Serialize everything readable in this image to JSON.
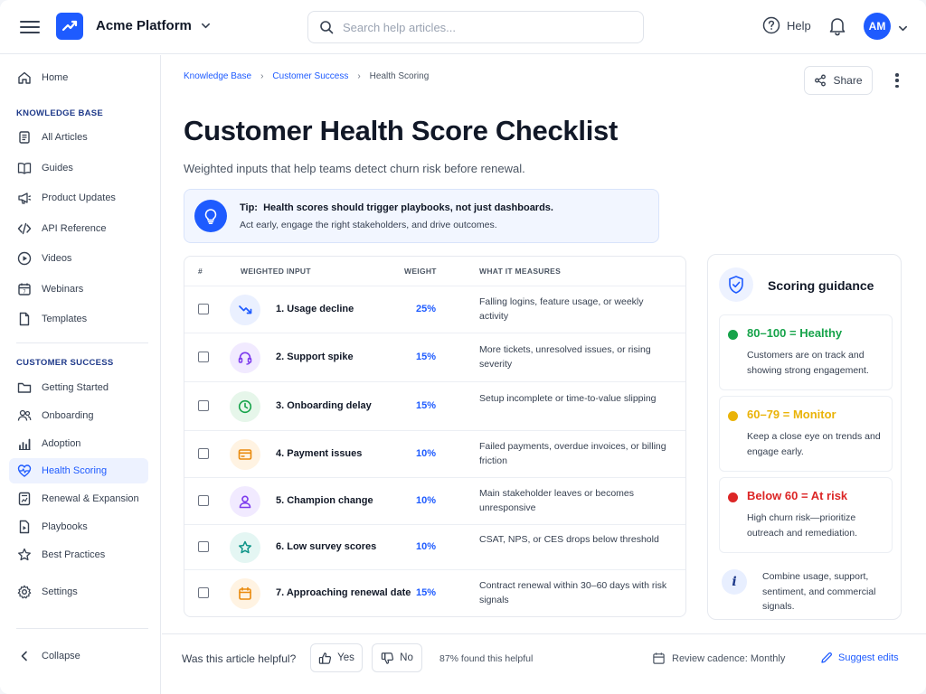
{
  "header": {
    "brand": "Acme Platform",
    "search_placeholder": "Search help articles...",
    "help_label": "Help",
    "avatar_initials": "AM"
  },
  "sidebar": {
    "home": "Home",
    "section_kb": "KNOWLEDGE BASE",
    "kb_items": [
      "All Articles",
      "Guides",
      "Product Updates",
      "API Reference",
      "Videos",
      "Webinars",
      "Templates"
    ],
    "section_cs": "CUSTOMER SUCCESS",
    "cs_items": [
      "Getting Started",
      "Onboarding",
      "Adoption",
      "Health Scoring",
      "Renewal & Expansion",
      "Playbooks",
      "Best Practices"
    ],
    "active_item": "Health Scoring",
    "settings": "Settings",
    "collapse": "Collapse"
  },
  "breadcrumb": {
    "items": [
      "Knowledge Base",
      "Customer Success"
    ],
    "current": "Health Scoring"
  },
  "share_label": "Share",
  "article": {
    "title": "Customer Health Score Checklist",
    "subtitle": "Weighted inputs that help teams detect churn risk before renewal.",
    "tip_prefix": "Tip:",
    "tip_headline": "Health scores should trigger playbooks, not just dashboards.",
    "tip_body": "Act early, engage the right stakeholders, and drive outcomes."
  },
  "table": {
    "headers": [
      "#",
      "WEIGHTED INPUT",
      "WEIGHT",
      "WHAT IT MEASURES"
    ],
    "rows": [
      {
        "name": "1. Usage decline",
        "weight": "25%",
        "desc": "Falling logins, feature usage, or weekly activity",
        "icon": "trend-down-icon"
      },
      {
        "name": "2. Support spike",
        "weight": "15%",
        "desc": "More tickets, unresolved issues, or rising severity",
        "icon": "headset-icon"
      },
      {
        "name": "3. Onboarding delay",
        "weight": "15%",
        "desc": "Setup incomplete or time-to-value slipping",
        "icon": "clock-icon"
      },
      {
        "name": "4. Payment issues",
        "weight": "10%",
        "desc": "Failed payments, overdue invoices, or billing friction",
        "icon": "credit-card-icon"
      },
      {
        "name": "5. Champion change",
        "weight": "10%",
        "desc": "Main stakeholder leaves or becomes unresponsive",
        "icon": "user-icon"
      },
      {
        "name": "6. Low survey scores",
        "weight": "10%",
        "desc": "CSAT, NPS, or CES drops below threshold",
        "icon": "star-icon"
      },
      {
        "name": "7. Approaching renewal date",
        "weight": "15%",
        "desc": "Contract renewal within 30–60 days with risk signals",
        "icon": "calendar-icon"
      }
    ]
  },
  "guidance": {
    "title": "Scoring guidance",
    "tiers": [
      {
        "label": "80–100 = Healthy",
        "desc": "Customers are on track and showing strong engagement.",
        "color": "#16a34a"
      },
      {
        "label": "60–79 = Monitor",
        "desc": "Keep a close eye on trends and engage early.",
        "color": "#eab308"
      },
      {
        "label": "Below 60 = At risk",
        "desc": "High churn risk—prioritize outreach and remediation.",
        "color": "#dc2626"
      }
    ],
    "note": "Combine usage, support, sentiment, and commercial signals."
  },
  "footer": {
    "question": "Was this article helpful?",
    "yes": "Yes",
    "no": "No",
    "percent_text": "87% found this helpful",
    "cadence": "Review cadence: Monthly",
    "suggest": "Suggest edits"
  }
}
